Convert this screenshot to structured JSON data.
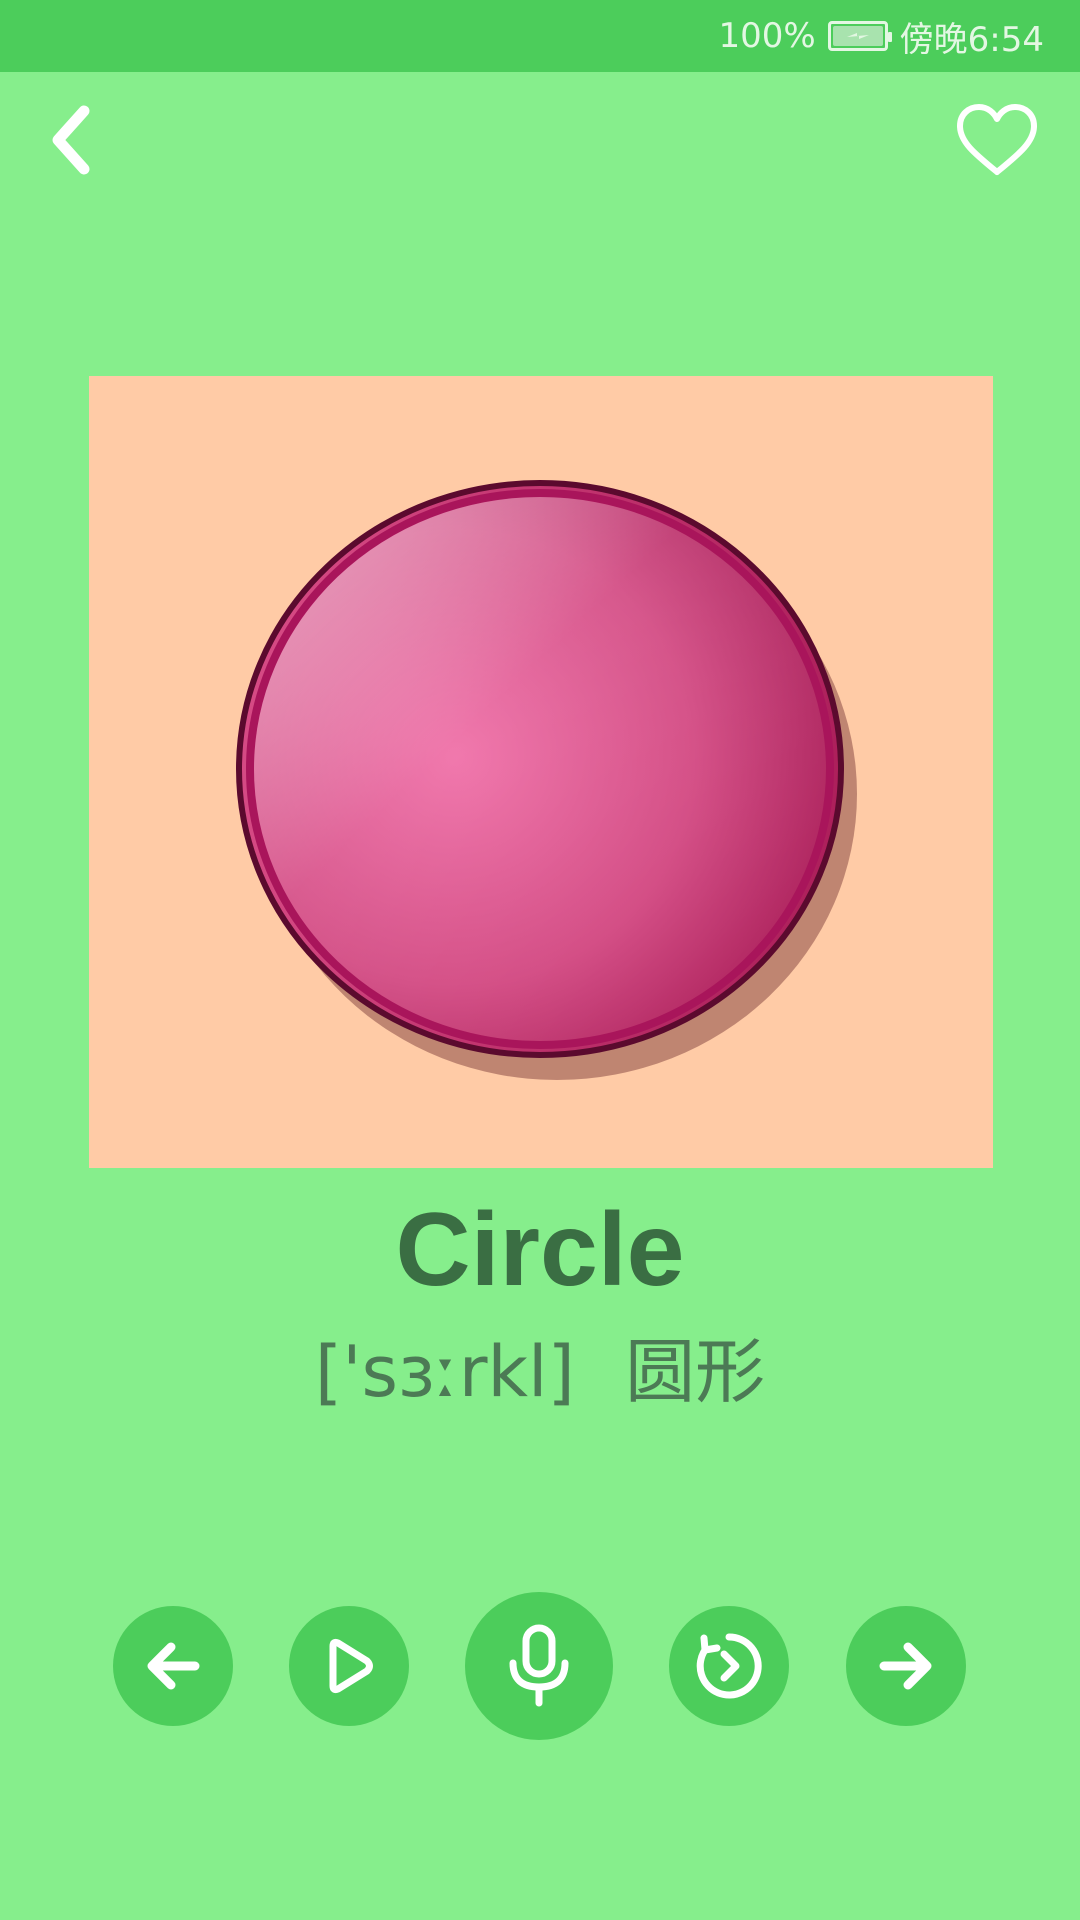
{
  "status_bar": {
    "battery_percent": "100%",
    "time": "傍晚6:54",
    "icons": [
      "battery-charging-icon"
    ]
  },
  "header": {
    "back_icon": "chevron-left-icon",
    "favorite_icon": "heart-outline-icon"
  },
  "flashcard": {
    "image": "pink-circle",
    "word": "Circle",
    "phonetic": "['sɜːrkl]",
    "translation": "圆形"
  },
  "controls": [
    {
      "name": "previous",
      "icon": "arrow-left-icon"
    },
    {
      "name": "play",
      "icon": "play-icon"
    },
    {
      "name": "record",
      "icon": "microphone-icon"
    },
    {
      "name": "replay",
      "icon": "replay-icon"
    },
    {
      "name": "next",
      "icon": "arrow-right-icon"
    }
  ],
  "colors": {
    "background": "#86ee8c",
    "status_bar": "#4ccd5b",
    "button": "#4ccd5b",
    "card": "#ffcba6",
    "word_text": "#3a6e43",
    "circle": "#e0699f"
  }
}
